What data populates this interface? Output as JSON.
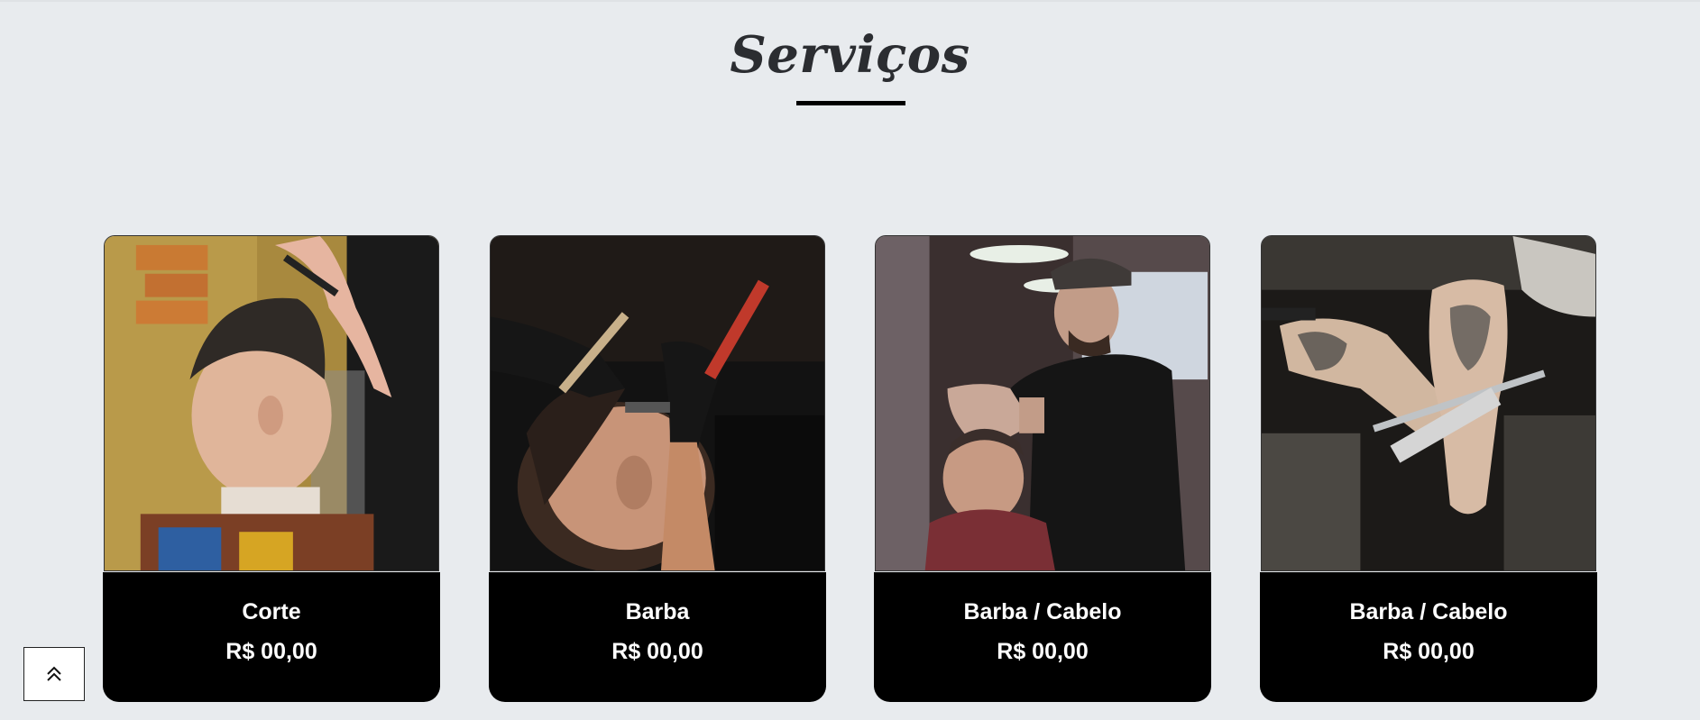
{
  "section": {
    "title": "Serviços"
  },
  "services": [
    {
      "name": "Corte",
      "price": "R$ 00,00"
    },
    {
      "name": "Barba",
      "price": "R$ 00,00"
    },
    {
      "name": "Barba / Cabelo",
      "price": "R$ 00,00"
    },
    {
      "name": "Barba / Cabelo",
      "price": "R$ 00,00"
    }
  ],
  "back_to_top": {
    "icon": "double-chevron-up-icon"
  },
  "colors": {
    "background": "#e8ebee",
    "card_footer": "#000000",
    "title_text": "#2b2d31"
  }
}
